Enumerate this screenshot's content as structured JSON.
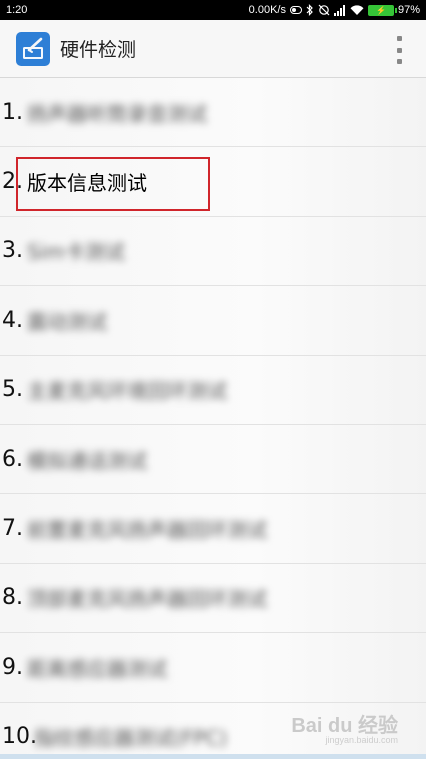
{
  "status_bar": {
    "time": "1:20",
    "net_speed": "0.00K/s",
    "battery": "97%"
  },
  "action_bar": {
    "title": "硬件检测"
  },
  "list": {
    "items": [
      {
        "number": "1.",
        "label": "扬声器听筒录音测试",
        "blurred": true
      },
      {
        "number": "2.",
        "label": "版本信息测试",
        "blurred": false
      },
      {
        "number": "3.",
        "label": "Sim卡测试",
        "blurred": true
      },
      {
        "number": "4.",
        "label": "震动测试",
        "blurred": true
      },
      {
        "number": "5.",
        "label": "主麦克风环境回环测试",
        "blurred": true
      },
      {
        "number": "6.",
        "label": "模拟通话测试",
        "blurred": true
      },
      {
        "number": "7.",
        "label": "前置麦克风扬声器回环测试",
        "blurred": true
      },
      {
        "number": "8.",
        "label": "顶部麦克风扬声器回环测试",
        "blurred": true
      },
      {
        "number": "9.",
        "label": "距离感应器测试",
        "blurred": true
      },
      {
        "number": "10.",
        "label": "指纹感应器测试(FPC)",
        "blurred": true
      }
    ]
  },
  "watermark": {
    "brand": "Bai du 经验",
    "url": "jingyan.baidu.com"
  }
}
